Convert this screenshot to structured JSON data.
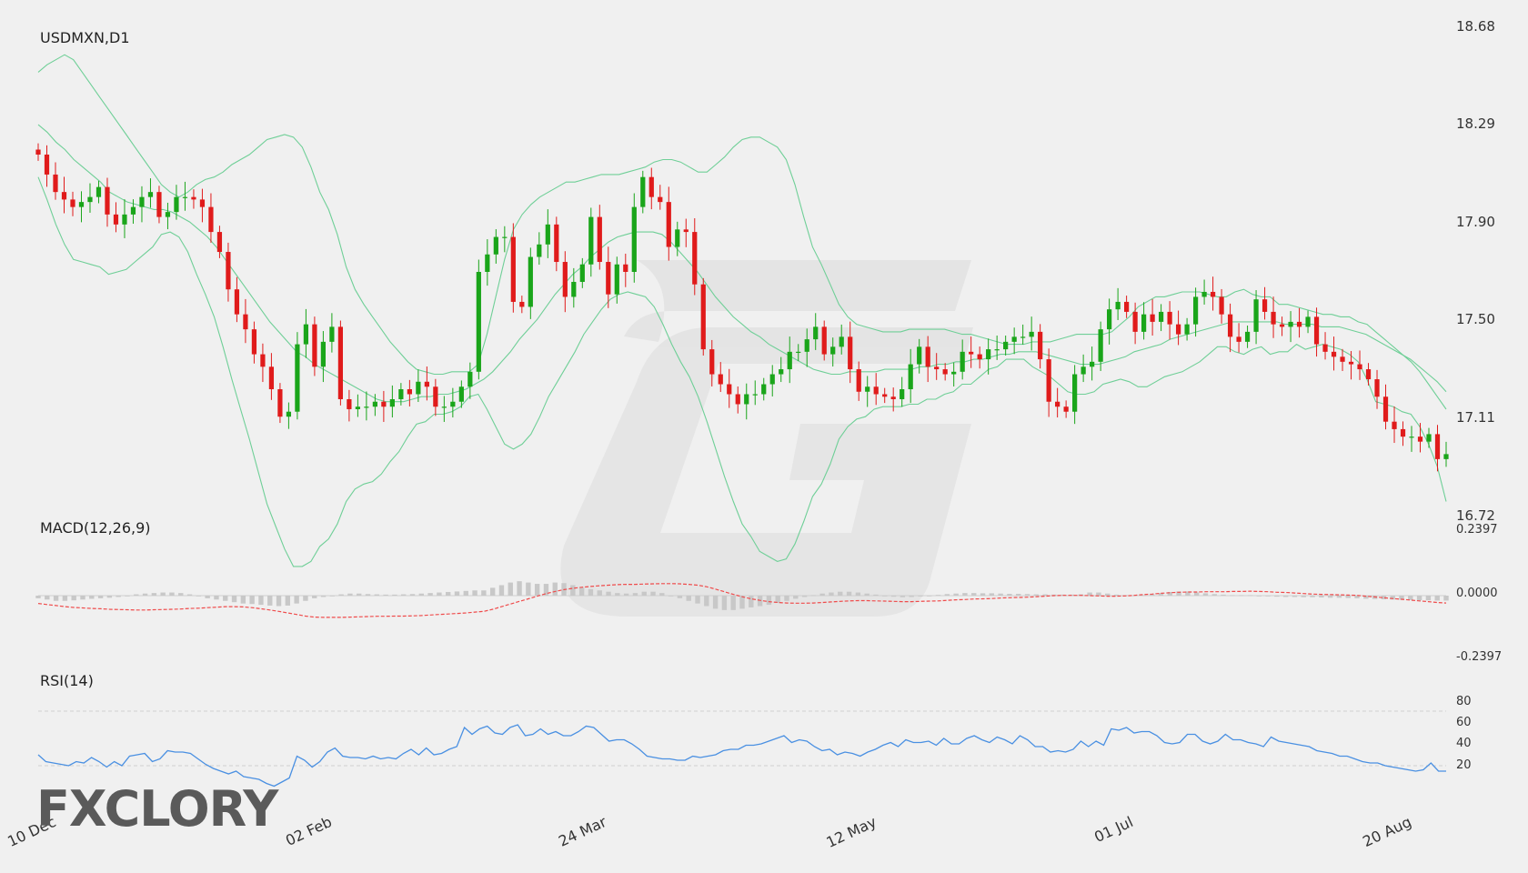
{
  "chart_data": {
    "type": "candlestick",
    "symbol_title": "USDMXN,D1",
    "price_axis": {
      "ticks": [
        "18.68",
        "18.29",
        "17.90",
        "17.50",
        "17.11",
        "16.72"
      ],
      "range": [
        16.72,
        18.68
      ]
    },
    "x_labels": [
      "10 Dec",
      "02 Feb",
      "24 Mar",
      "12 May",
      "01 Jul",
      "20 Aug"
    ],
    "colors": {
      "up": "#1aa51a",
      "down": "#e01b1b",
      "bands": "#6fcf97",
      "macd_signal": "#ef4b4b",
      "macd_hist": "#c8c8c8",
      "rsi": "#4a90e2",
      "ref_lines": "#cfcfcf"
    },
    "closes": [
      18.17,
      18.09,
      18.02,
      17.99,
      17.96,
      17.98,
      18.0,
      18.04,
      17.93,
      17.89,
      17.93,
      17.96,
      18.0,
      18.02,
      17.92,
      17.94,
      18.0,
      18.0,
      17.99,
      17.96,
      17.86,
      17.78,
      17.63,
      17.53,
      17.47,
      17.37,
      17.32,
      17.23,
      17.12,
      17.14,
      17.41,
      17.49,
      17.32,
      17.42,
      17.48,
      17.19,
      17.15,
      17.16,
      17.16,
      17.18,
      17.16,
      17.19,
      17.23,
      17.21,
      17.26,
      17.24,
      17.16,
      17.16,
      17.18,
      17.24,
      17.3,
      17.7,
      17.77,
      17.84,
      17.84,
      17.58,
      17.56,
      17.76,
      17.81,
      17.89,
      17.74,
      17.6,
      17.66,
      17.73,
      17.92,
      17.74,
      17.61,
      17.73,
      17.7,
      17.96,
      18.08,
      18.0,
      17.98,
      17.8,
      17.87,
      17.86,
      17.65,
      17.39,
      17.29,
      17.25,
      17.21,
      17.17,
      17.21,
      17.21,
      17.25,
      17.29,
      17.31,
      17.38,
      17.38,
      17.43,
      17.48,
      17.37,
      17.4,
      17.44,
      17.31,
      17.22,
      17.24,
      17.21,
      17.2,
      17.19,
      17.23,
      17.33,
      17.4,
      17.32,
      17.31,
      17.29,
      17.3,
      17.38,
      17.37,
      17.35,
      17.39,
      17.39,
      17.42,
      17.44,
      17.44,
      17.46,
      17.35,
      17.18,
      17.16,
      17.14,
      17.29,
      17.32,
      17.34,
      17.47,
      17.55,
      17.58,
      17.54,
      17.46,
      17.53,
      17.5,
      17.54,
      17.49,
      17.45,
      17.49,
      17.6,
      17.62,
      17.6,
      17.53,
      17.44,
      17.42,
      17.46,
      17.59,
      17.54,
      17.49,
      17.48,
      17.5,
      17.48,
      17.52,
      17.41,
      17.38,
      17.36,
      17.34,
      17.33,
      17.31,
      17.27,
      17.2,
      17.1,
      17.07,
      17.04,
      17.04,
      17.02,
      17.05,
      16.95,
      16.97
    ],
    "bollinger_upper": [
      18.5,
      18.53,
      18.55,
      18.57,
      18.55,
      18.5,
      18.45,
      18.4,
      18.35,
      18.3,
      18.25,
      18.2,
      18.15,
      18.1,
      18.05,
      18.02,
      18.0,
      18.02,
      18.05,
      18.07,
      18.08,
      18.1,
      18.13,
      18.15,
      18.17,
      18.2,
      18.23,
      18.24,
      18.25,
      18.24,
      18.2,
      18.12,
      18.02,
      17.95,
      17.85,
      17.72,
      17.63,
      17.57,
      17.52,
      17.47,
      17.42,
      17.38,
      17.34,
      17.31,
      17.3,
      17.29,
      17.29,
      17.3,
      17.3,
      17.3,
      17.33,
      17.45,
      17.6,
      17.75,
      17.87,
      17.93,
      17.97,
      18.0,
      18.02,
      18.04,
      18.06,
      18.06,
      18.07,
      18.08,
      18.09,
      18.09,
      18.09,
      18.1,
      18.11,
      18.12,
      18.14,
      18.15,
      18.15,
      18.14,
      18.12,
      18.1,
      18.1,
      18.13,
      18.16,
      18.2,
      18.23,
      18.24,
      18.24,
      18.22,
      18.2,
      18.15,
      18.05,
      17.92,
      17.8,
      17.73,
      17.65,
      17.57,
      17.52,
      17.49,
      17.48,
      17.47,
      17.46,
      17.46,
      17.46,
      17.47,
      17.47,
      17.47,
      17.47,
      17.47,
      17.46,
      17.45,
      17.45,
      17.44,
      17.43,
      17.42,
      17.41,
      17.41,
      17.41,
      17.42,
      17.42,
      17.42,
      17.43,
      17.44,
      17.45,
      17.45,
      17.45,
      17.45,
      17.46,
      17.49,
      17.52,
      17.56,
      17.58,
      17.6,
      17.6,
      17.61,
      17.62,
      17.62,
      17.62,
      17.61,
      17.6,
      17.6,
      17.62,
      17.63,
      17.61,
      17.6,
      17.6,
      17.57,
      17.57,
      17.56,
      17.55,
      17.54,
      17.53,
      17.53,
      17.52,
      17.52,
      17.5,
      17.49,
      17.46,
      17.43,
      17.4,
      17.37,
      17.34,
      17.3,
      17.25,
      17.2,
      17.15
    ],
    "bollinger_middle": [
      18.29,
      18.26,
      18.22,
      18.19,
      18.15,
      18.12,
      18.09,
      18.06,
      18.02,
      18.0,
      17.98,
      17.97,
      17.96,
      17.95,
      17.95,
      17.94,
      17.92,
      17.9,
      17.87,
      17.84,
      17.8,
      17.75,
      17.7,
      17.65,
      17.6,
      17.55,
      17.5,
      17.46,
      17.42,
      17.38,
      17.36,
      17.33,
      17.31,
      17.29,
      17.27,
      17.25,
      17.23,
      17.21,
      17.19,
      17.18,
      17.18,
      17.18,
      17.19,
      17.2,
      17.2,
      17.21,
      17.21,
      17.22,
      17.23,
      17.25,
      17.27,
      17.3,
      17.34,
      17.38,
      17.43,
      17.47,
      17.51,
      17.56,
      17.61,
      17.65,
      17.69,
      17.72,
      17.76,
      17.79,
      17.82,
      17.84,
      17.85,
      17.86,
      17.86,
      17.86,
      17.85,
      17.82,
      17.78,
      17.74,
      17.7,
      17.65,
      17.6,
      17.56,
      17.52,
      17.49,
      17.46,
      17.44,
      17.41,
      17.39,
      17.37,
      17.35,
      17.33,
      17.31,
      17.3,
      17.29,
      17.29,
      17.3,
      17.3,
      17.3,
      17.3,
      17.31,
      17.31,
      17.31,
      17.31,
      17.32,
      17.32,
      17.33,
      17.33,
      17.34,
      17.34,
      17.35,
      17.35,
      17.36,
      17.37,
      17.37,
      17.38,
      17.38,
      17.38,
      17.37,
      17.36,
      17.35,
      17.34,
      17.33,
      17.33,
      17.33,
      17.34,
      17.35,
      17.36,
      17.38,
      17.39,
      17.4,
      17.41,
      17.43,
      17.44,
      17.45,
      17.46,
      17.47,
      17.48,
      17.49,
      17.5,
      17.5,
      17.5,
      17.5,
      17.5,
      17.5,
      17.49,
      17.49,
      17.49,
      17.49,
      17.48,
      17.48,
      17.48,
      17.47,
      17.46,
      17.45,
      17.43,
      17.41,
      17.39,
      17.37,
      17.35,
      17.32,
      17.29,
      17.26,
      17.22
    ],
    "bollinger_lower": [
      18.08,
      17.99,
      17.89,
      17.81,
      17.75,
      17.74,
      17.73,
      17.72,
      17.69,
      17.7,
      17.71,
      17.74,
      17.77,
      17.8,
      17.85,
      17.86,
      17.84,
      17.78,
      17.69,
      17.61,
      17.52,
      17.4,
      17.27,
      17.15,
      17.03,
      16.9,
      16.77,
      16.68,
      16.59,
      16.52,
      16.52,
      16.54,
      16.6,
      16.63,
      16.69,
      16.78,
      16.83,
      16.85,
      16.86,
      16.89,
      16.94,
      16.98,
      17.04,
      17.09,
      17.1,
      17.13,
      17.13,
      17.14,
      17.16,
      17.2,
      17.21,
      17.15,
      17.08,
      17.01,
      16.99,
      17.01,
      17.05,
      17.12,
      17.2,
      17.26,
      17.32,
      17.38,
      17.45,
      17.5,
      17.55,
      17.59,
      17.61,
      17.62,
      17.61,
      17.6,
      17.56,
      17.49,
      17.41,
      17.34,
      17.28,
      17.2,
      17.1,
      16.99,
      16.88,
      16.78,
      16.69,
      16.64,
      16.58,
      16.56,
      16.54,
      16.55,
      16.61,
      16.7,
      16.8,
      16.85,
      16.93,
      17.03,
      17.08,
      17.11,
      17.12,
      17.15,
      17.16,
      17.16,
      17.16,
      17.17,
      17.17,
      17.19,
      17.19,
      17.21,
      17.22,
      17.25,
      17.25,
      17.28,
      17.31,
      17.32,
      17.35,
      17.35,
      17.35,
      17.32,
      17.3,
      17.28,
      17.25,
      17.22,
      17.21,
      17.21,
      17.22,
      17.25,
      17.26,
      17.27,
      17.26,
      17.24,
      17.24,
      17.26,
      17.28,
      17.29,
      17.3,
      17.32,
      17.34,
      17.37,
      17.4,
      17.4,
      17.38,
      17.37,
      17.39,
      17.4,
      17.37,
      17.38,
      17.38,
      17.41,
      17.39,
      17.4,
      17.41,
      17.4,
      17.39,
      17.37,
      17.34,
      17.27,
      17.18,
      17.17,
      17.16,
      17.14,
      17.13,
      17.08,
      17.01,
      16.92,
      16.78
    ],
    "macd": {
      "title": "MACD(12,26,9)",
      "ticks": [
        "0.2397",
        "0.0000",
        "-0.2397"
      ],
      "range": [
        -0.2397,
        0.2397
      ],
      "hist": [
        -0.01,
        -0.015,
        -0.02,
        -0.02,
        -0.018,
        -0.015,
        -0.012,
        -0.01,
        -0.008,
        -0.005,
        0.0,
        0.005,
        0.008,
        0.01,
        0.012,
        0.012,
        0.01,
        0.005,
        -0.002,
        -0.01,
        -0.015,
        -0.02,
        -0.025,
        -0.03,
        -0.032,
        -0.035,
        -0.038,
        -0.04,
        -0.038,
        -0.03,
        -0.02,
        -0.01,
        -0.005,
        0.0,
        0.005,
        0.008,
        0.008,
        0.006,
        0.005,
        0.004,
        0.004,
        0.005,
        0.006,
        0.008,
        0.01,
        0.012,
        0.014,
        0.016,
        0.018,
        0.02,
        0.02,
        0.03,
        0.04,
        0.05,
        0.055,
        0.05,
        0.045,
        0.045,
        0.05,
        0.048,
        0.04,
        0.03,
        0.025,
        0.02,
        0.015,
        0.01,
        0.008,
        0.01,
        0.015,
        0.015,
        0.01,
        0.0,
        -0.01,
        -0.02,
        -0.03,
        -0.04,
        -0.05,
        -0.055,
        -0.055,
        -0.05,
        -0.045,
        -0.04,
        -0.035,
        -0.028,
        -0.02,
        -0.012,
        -0.005,
        0.002,
        0.008,
        0.012,
        0.015,
        0.015,
        0.012,
        0.008,
        0.004,
        0.0,
        -0.004,
        -0.006,
        -0.005,
        -0.003,
        0.0,
        0.003,
        0.006,
        0.008,
        0.01,
        0.01,
        0.009,
        0.009,
        0.008,
        0.007,
        0.007,
        0.006,
        0.005,
        0.005,
        0.004,
        0.004,
        0.004,
        0.005,
        0.012,
        0.012,
        0.008,
        0.004,
        0.002,
        0.001,
        0.002,
        0.005,
        0.01,
        0.014,
        0.016,
        0.016,
        0.012,
        0.009,
        0.006,
        0.004,
        0.002,
        0.002,
        0.002,
        0.0,
        -0.002,
        -0.004,
        -0.005,
        -0.005,
        -0.006,
        -0.006,
        -0.007,
        -0.008,
        -0.008,
        -0.009,
        -0.01,
        -0.012,
        -0.013,
        -0.014,
        -0.015,
        -0.016,
        -0.017,
        -0.018,
        -0.018,
        -0.019,
        -0.019
      ],
      "signal": [
        -0.03,
        -0.034,
        -0.038,
        -0.042,
        -0.045,
        -0.047,
        -0.049,
        -0.05,
        -0.052,
        -0.053,
        -0.054,
        -0.055,
        -0.055,
        -0.054,
        -0.053,
        -0.052,
        -0.051,
        -0.049,
        -0.048,
        -0.046,
        -0.044,
        -0.042,
        -0.042,
        -0.043,
        -0.046,
        -0.05,
        -0.055,
        -0.06,
        -0.066,
        -0.072,
        -0.078,
        -0.082,
        -0.083,
        -0.083,
        -0.083,
        -0.082,
        -0.081,
        -0.08,
        -0.079,
        -0.079,
        -0.078,
        -0.078,
        -0.077,
        -0.076,
        -0.074,
        -0.072,
        -0.07,
        -0.068,
        -0.066,
        -0.063,
        -0.06,
        -0.052,
        -0.042,
        -0.032,
        -0.022,
        -0.012,
        -0.002,
        0.008,
        0.016,
        0.023,
        0.028,
        0.032,
        0.035,
        0.038,
        0.04,
        0.042,
        0.043,
        0.043,
        0.044,
        0.045,
        0.046,
        0.046,
        0.045,
        0.043,
        0.04,
        0.034,
        0.025,
        0.015,
        0.005,
        -0.004,
        -0.012,
        -0.018,
        -0.023,
        -0.026,
        -0.028,
        -0.029,
        -0.029,
        -0.028,
        -0.026,
        -0.024,
        -0.022,
        -0.02,
        -0.019,
        -0.019,
        -0.02,
        -0.021,
        -0.022,
        -0.023,
        -0.023,
        -0.022,
        -0.021,
        -0.02,
        -0.018,
        -0.016,
        -0.015,
        -0.013,
        -0.012,
        -0.011,
        -0.009,
        -0.008,
        -0.007,
        -0.006,
        -0.004,
        -0.002,
        0.0,
        0.001,
        0.001,
        0.001,
        0.0,
        -0.001,
        -0.002,
        -0.002,
        -0.001,
        0.001,
        0.004,
        0.006,
        0.009,
        0.011,
        0.013,
        0.014,
        0.014,
        0.015,
        0.015,
        0.015,
        0.016,
        0.016,
        0.017,
        0.016,
        0.015,
        0.013,
        0.012,
        0.01,
        0.008,
        0.006,
        0.005,
        0.004,
        0.003,
        0.002,
        0.001,
        -0.002,
        -0.005,
        -0.008,
        -0.011,
        -0.014,
        -0.017,
        -0.02,
        -0.023,
        -0.026,
        -0.028
      ]
    },
    "rsi": {
      "title": "RSI(14)",
      "ticks": [
        "80",
        "60",
        "40",
        "20"
      ],
      "levels": [
        70,
        30
      ],
      "range": [
        10,
        90
      ],
      "values": [
        38,
        33,
        32,
        31,
        30,
        33,
        32,
        36,
        33,
        29,
        33,
        30,
        37,
        38,
        39,
        33,
        35,
        41,
        40,
        40,
        39,
        35,
        31,
        28,
        26,
        24,
        26,
        22,
        21,
        20,
        17,
        15,
        18,
        21,
        37,
        34,
        29,
        33,
        40,
        43,
        37,
        36,
        36,
        35,
        37,
        35,
        36,
        35,
        39,
        42,
        38,
        43,
        38,
        39,
        42,
        44,
        58,
        53,
        57,
        59,
        54,
        53,
        58,
        60,
        52,
        53,
        57,
        53,
        55,
        52,
        52,
        55,
        59,
        58,
        53,
        48,
        49,
        49,
        46,
        42,
        37,
        36,
        35,
        35,
        34,
        34,
        37,
        36,
        37,
        38,
        41,
        42,
        42,
        45,
        45,
        46,
        48,
        50,
        52,
        47,
        49,
        48,
        44,
        41,
        42,
        38,
        40,
        39,
        37,
        40,
        42,
        45,
        47,
        44,
        49,
        47,
        47,
        48,
        45,
        50,
        46,
        46,
        50,
        52,
        49,
        47,
        51,
        49,
        46,
        52,
        49,
        44,
        44,
        40,
        41,
        40,
        42,
        48,
        44,
        48,
        45,
        57,
        56,
        58,
        54,
        55,
        55,
        52,
        47,
        46,
        47,
        53,
        53,
        48,
        46,
        48,
        53,
        49,
        49,
        47,
        46,
        44,
        51,
        48,
        47,
        46,
        45,
        44,
        41,
        40,
        39,
        37,
        37,
        35,
        33,
        32,
        32,
        30,
        29,
        28,
        27,
        26,
        27,
        32,
        26,
        26
      ]
    }
  },
  "logo": {
    "text_left": "F",
    "text_right": "CLORY",
    "x_mark": "X"
  }
}
